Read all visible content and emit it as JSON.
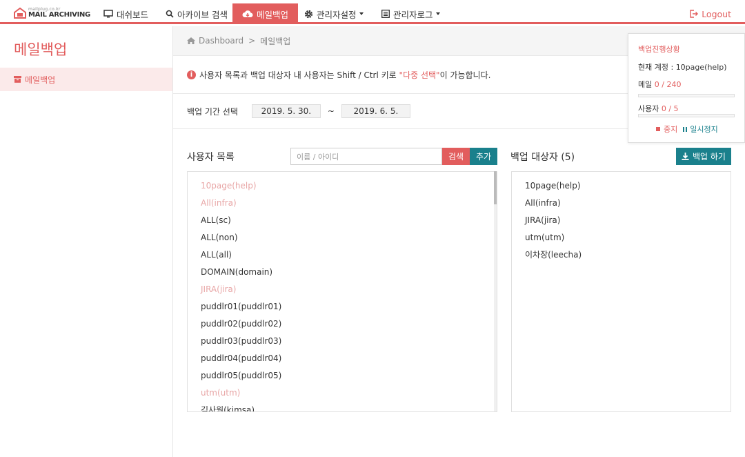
{
  "logo": {
    "small": "mailplug.co.kr",
    "big": "MAIL ARCHIVING"
  },
  "nav": {
    "dashboard": "대쉬보드",
    "archive_search": "아카이브 검색",
    "mail_backup": "메일백업",
    "admin_settings": "관리자설정",
    "admin_log": "관리자로그",
    "logout": "Logout"
  },
  "sidebar": {
    "title": "메일백업",
    "item": "메일백업"
  },
  "breadcrumb": {
    "home": "Dashboard",
    "sep": ">",
    "current": "메일백업"
  },
  "info": {
    "prefix": "사용자 목록과 백업 대상자 내 사용자는 Shift / Ctrl 키로 ",
    "highlight": "\"다중 선택\"",
    "suffix": "이 가능합니다."
  },
  "period": {
    "label": "백업 기간 선택",
    "start": "2019. 5. 30.",
    "tilde": "~",
    "end": "2019. 6. 5."
  },
  "user_list": {
    "title": "사용자 목록",
    "search_placeholder": "이름 / 아이디",
    "search_button": "검색",
    "add_button": "추가",
    "items": [
      {
        "label": "10page(help)",
        "selected_in_target": true
      },
      {
        "label": "All(infra)",
        "selected_in_target": true
      },
      {
        "label": "ALL(sc)",
        "selected_in_target": false
      },
      {
        "label": "ALL(non)",
        "selected_in_target": false
      },
      {
        "label": "ALL(all)",
        "selected_in_target": false
      },
      {
        "label": "DOMAIN(domain)",
        "selected_in_target": false
      },
      {
        "label": "JIRA(jira)",
        "selected_in_target": true
      },
      {
        "label": "puddlr01(puddlr01)",
        "selected_in_target": false
      },
      {
        "label": "puddlr02(puddlr02)",
        "selected_in_target": false
      },
      {
        "label": "puddlr03(puddlr03)",
        "selected_in_target": false
      },
      {
        "label": "puddlr04(puddlr04)",
        "selected_in_target": false
      },
      {
        "label": "puddlr05(puddlr05)",
        "selected_in_target": false
      },
      {
        "label": "utm(utm)",
        "selected_in_target": true
      },
      {
        "label": "김사원(kimsa)",
        "selected_in_target": false
      }
    ]
  },
  "target_list": {
    "title": "백업 대상자 (5)",
    "backup_button": "백업 하기",
    "items": [
      "10page(help)",
      "All(infra)",
      "JIRA(jira)",
      "utm(utm)",
      "이차장(leecha)"
    ]
  },
  "progress": {
    "title": "백업진행상황",
    "account_label": "현재 계정 : ",
    "account_value": "10page(help)",
    "mail_label": "메일 ",
    "mail_value": "0 / 240",
    "mail_fraction": 0,
    "user_label": "사용자 ",
    "user_value": "0 / 5",
    "user_fraction": 0,
    "stop": "중지",
    "pause": "일시정지"
  },
  "colors": {
    "accent": "#e25d5d",
    "teal": "#1a808c"
  }
}
